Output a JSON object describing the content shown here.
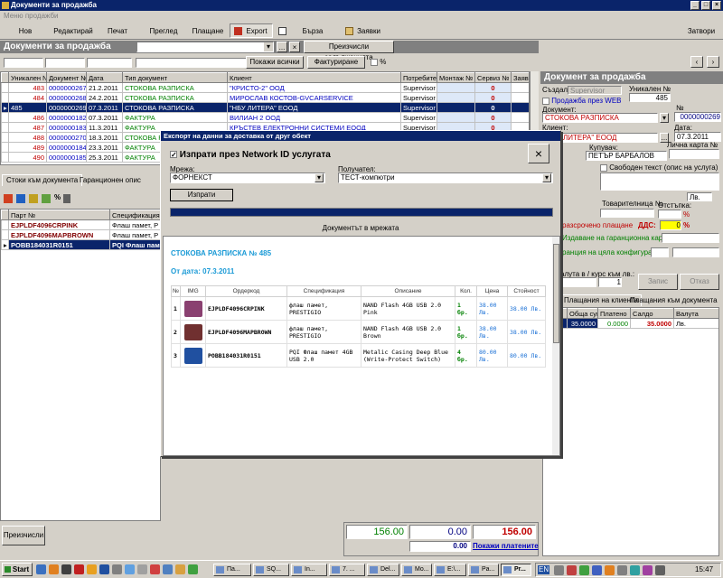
{
  "window": {
    "title": "Документи за продажба",
    "menu": "Меню продажби"
  },
  "toolbar": {
    "new": "Нов документ",
    "edit": "Редактирай",
    "print": "Печат",
    "preview": "Преглед",
    "pay": "Плащане",
    "export": "Export",
    "quick_sale": "Бърза продажба",
    "requests": "Заявки",
    "close": "Затвори"
  },
  "list_panel": {
    "title": "Документи за продажба",
    "recalc": "Преизчисли задълженията",
    "show_all": "Покажи всички",
    "invoicing": "Фактуриране",
    "percent": "%",
    "columns": [
      "Уникален №",
      "Документ №",
      "Дата",
      "Тип документ",
      "Клиент",
      "Потребител",
      "Монтаж №",
      "Сервиз №",
      "Заяв"
    ],
    "rows": [
      [
        "483",
        "0000000267",
        "21.2.2011",
        "СТОКОВА РАЗПИСКА",
        "\"КРИСТО-2\" ООД",
        "Supervisor",
        "",
        "0"
      ],
      [
        "484",
        "0000000268",
        "24.2.2011",
        "СТОКОВА РАЗПИСКА",
        "МИРОСЛАВ КОСТОВ-GVCARSERVICE",
        "Supervisor",
        "",
        "0"
      ],
      [
        "485",
        "0000000269",
        "07.3.2011",
        "СТОКОВА РАЗПИСКА",
        "\"НБУ ЛИТЕРА\" ЕООД",
        "Supervisor",
        "",
        "0"
      ],
      [
        "486",
        "0000000182",
        "07.3.2011",
        "ФАКТУРА",
        "ВИЛИАН 2 ООД",
        "Supervisor",
        "",
        "0"
      ],
      [
        "487",
        "0000000183",
        "11.3.2011",
        "ФАКТУРА",
        "КРЪСТЕВ ЕЛЕКТРОННИ СИСТЕМИ ЕООД",
        "Supervisor",
        "",
        "0"
      ],
      [
        "488",
        "0000000270",
        "18.3.2011",
        "СТОКОВА РАЗПИСКА",
        "",
        "Supervisor",
        "",
        "0"
      ],
      [
        "489",
        "0000000184",
        "23.3.2011",
        "ФАКТУРА",
        "",
        "Supervisor",
        "",
        "0"
      ],
      [
        "490",
        "0000000185",
        "25.3.2011",
        "ФАКТУРА",
        "",
        "Supervisor",
        "",
        "0"
      ]
    ]
  },
  "bottom_tabs": [
    "Стоки към документа",
    "Гаранционен опис"
  ],
  "goods": {
    "columns": [
      "Парт №",
      "Спецификация"
    ],
    "rows": [
      [
        "EJPLDF4096CRPINK",
        "Флаш памет, P"
      ],
      [
        "EJPLDF4096MAPBROWN",
        "Флаш памет, P"
      ],
      [
        "POBB184031R0151",
        "PQI Флаш пам"
      ]
    ]
  },
  "recalc_bottom": "Преизчисли",
  "totals": {
    "t1": "156.00",
    "t2": "0.00",
    "t3": "156.00",
    "t4": "0.00",
    "show_paid": "Покажи платените"
  },
  "doc_panel": {
    "title": "Документ за продажба",
    "created_label": "Създал:",
    "created_value": "Supervisor",
    "unique_label": "Уникален №",
    "unique_value": "485",
    "web_sale": "Продажба през WEB",
    "doc_label": "Документ:",
    "doc_value": "СТОКОВА РАЗПИСКА",
    "num_label": "№",
    "num_value": "0000000269",
    "client_label": "Клиент:",
    "client_value": "ЛИТЕРА\" ЕООД",
    "date_label": "Дата:",
    "date_value": "07.3.2011",
    "buyer_label": "Купувач:",
    "buyer_value": "ПЕТЪР БАРБАЛОВ",
    "id_label": "Лична карта №",
    "free_text": "Свободен текст (опис на услуга)",
    "waybill_label": "Товарителница №",
    "discount_label": "Отстъпка:",
    "deferred_label": "разсрочено плащане",
    "vat_label": "ДДС:",
    "vat_value": "0",
    "percent_sign": "%",
    "warranty_label": "Издаване на гаранционна карта №",
    "config_label": "ранция на цяла конфигурация",
    "rate_label": "алута в / курс към лв.:",
    "rate_value": "1",
    "write_btn": "Запис",
    "cancel_btn": "Отказ",
    "lv": "Лв."
  },
  "pay_tabs": [
    "Плащания на клиента",
    "Плащания към документа"
  ],
  "pay_grid": {
    "columns": [
      "Обща сума",
      "Платено",
      "Салдо",
      "Валута"
    ],
    "row": [
      "35.0000",
      "0.0000",
      "35.0000",
      "Лв."
    ]
  },
  "dialog": {
    "title": "Експорт на данни за доставка от друг обект",
    "send_check": "Изпрати през Network ID услугата",
    "network_label": "Мрежа:",
    "network_value": "ФОРНЕКСТ",
    "recipient_label": "Получател:",
    "recipient_value": "ТЕСТ-компютри",
    "send_btn": "Изпрати",
    "network_doc": "Документът в мрежата",
    "doc": {
      "heading": "СТОКОВА РАЗПИСКА № 485",
      "date_line": "От дата: 07.3.2011",
      "columns": [
        "№",
        "IMG",
        "Ордеркод",
        "Спецификация",
        "Описание",
        "Кол.",
        "Цена",
        "Стойност"
      ],
      "rows": [
        [
          "1",
          "EJPLDF4096CRPINK",
          "флаш памет, PRESTIGIO",
          "NAND Flash 4GB USB 2.0 Pink",
          "1 бр.",
          "38.00 Лв.",
          "38.00 Лв."
        ],
        [
          "2",
          "EJPLDF4096MAPBROWN",
          "флаш памет, PRESTIGIO",
          "NAND Flash 4GB USB 2.0 Brown",
          "1 бр.",
          "38.00 Лв.",
          "38.00 Лв."
        ],
        [
          "3",
          "POBB184031R0151",
          "PQI Флаш памет 4GB USB 2.0",
          "Metalic Casing Deep Blue (Write-Protect Switch)",
          "4 бр.",
          "80.00 Лв.",
          "80.00 Лв."
        ]
      ]
    }
  },
  "taskbar": {
    "start": "Start",
    "items": [
      "Па...",
      "SQ...",
      "In...",
      "7. ...",
      "Del...",
      "Mo...",
      "E:\\...",
      "Pa...",
      "Pr..."
    ],
    "lang": "EN",
    "time": "15:47"
  },
  "colors": {
    "title_bar": "#0a246a",
    "section": "#808080",
    "red": "#c00000",
    "green": "#008000",
    "blue": "#0000c0",
    "highlight": "#ffff00"
  }
}
